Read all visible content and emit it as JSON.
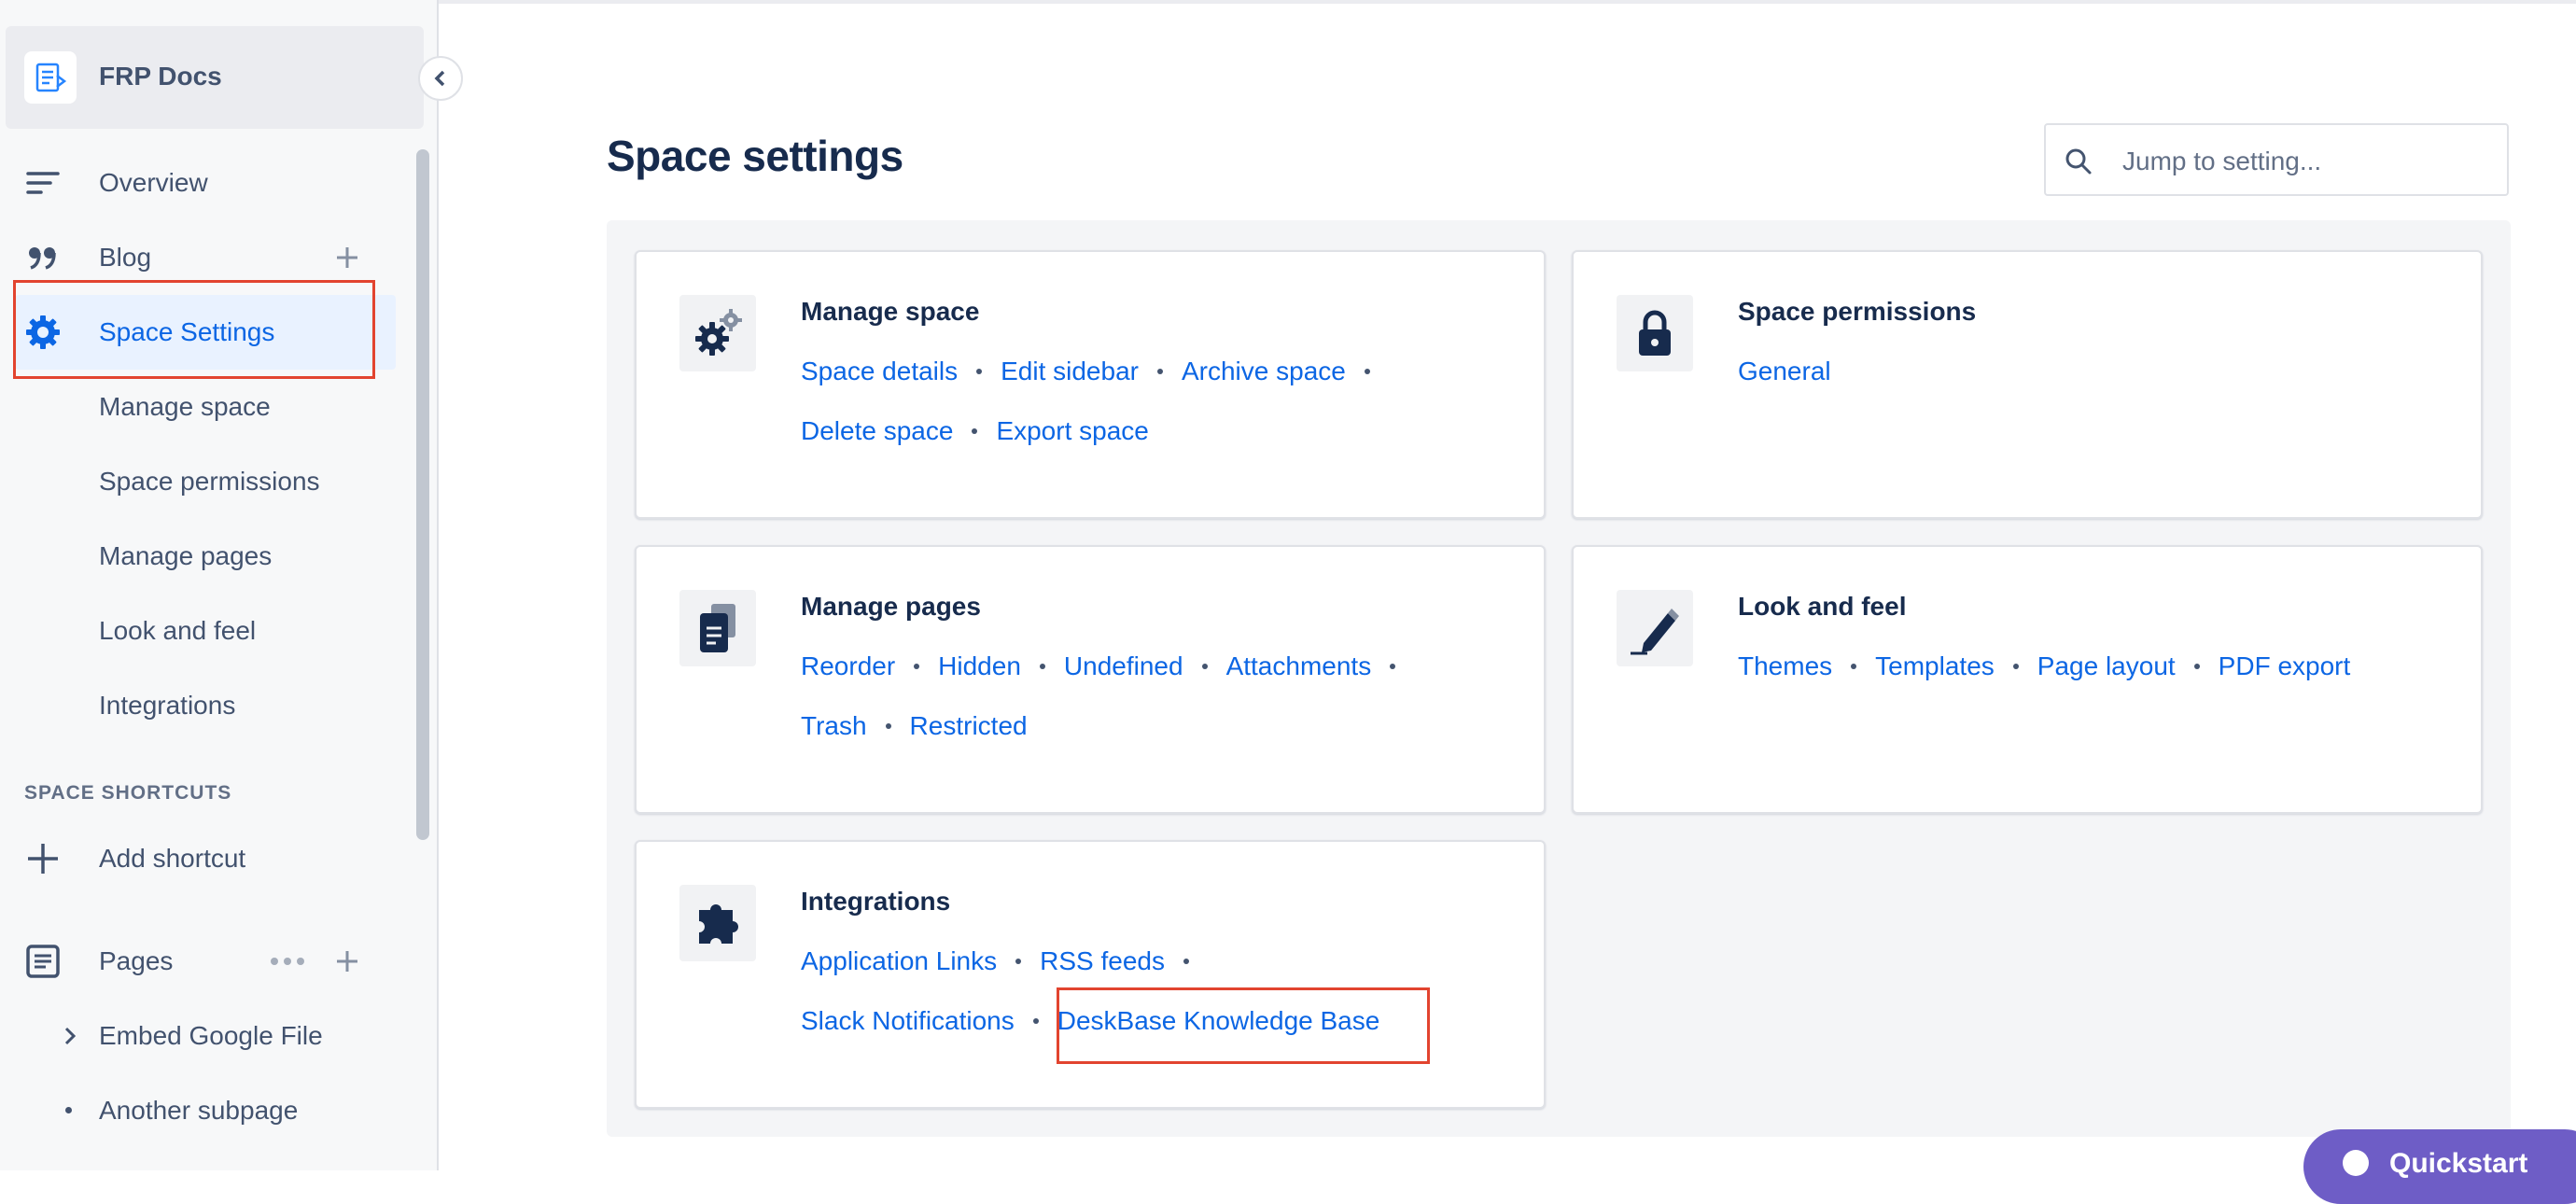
{
  "sidebar": {
    "space_title": "FRP Docs",
    "nav": {
      "overview": "Overview",
      "blog": "Blog",
      "space_settings": "Space Settings"
    },
    "settings_subitems": [
      "Manage space",
      "Space permissions",
      "Manage pages",
      "Look and feel",
      "Integrations"
    ],
    "shortcuts_heading": "SPACE SHORTCUTS",
    "add_shortcut": "Add shortcut",
    "pages_label": "Pages",
    "page_tree": [
      "Embed Google File",
      "Another subpage"
    ]
  },
  "main": {
    "title": "Space settings",
    "search": {
      "placeholder": "Jump to setting..."
    },
    "cards": {
      "manage_space": {
        "title": "Manage space",
        "links": [
          "Space details",
          "Edit sidebar",
          "Archive space",
          "Delete space",
          "Export space"
        ]
      },
      "space_permissions": {
        "title": "Space permissions",
        "links": [
          "General"
        ]
      },
      "manage_pages": {
        "title": "Manage pages",
        "links": [
          "Reorder",
          "Hidden",
          "Undefined",
          "Attachments",
          "Trash",
          "Restricted"
        ]
      },
      "look_and_feel": {
        "title": "Look and feel",
        "links": [
          "Themes",
          "Templates",
          "Page layout",
          "PDF export"
        ]
      },
      "integrations": {
        "title": "Integrations",
        "links": [
          "Application Links",
          "RSS feeds",
          "Slack Notifications",
          "DeskBase Knowledge Base"
        ]
      }
    },
    "quickstart_label": "Quickstart"
  },
  "icons": {
    "space_logo": "document-logo-icon",
    "collapse": "chevron-left-icon",
    "overview": "lines-icon",
    "blog": "quote-icon",
    "space_settings": "gear-icon",
    "add_shortcut": "plus-icon",
    "pages": "page-icon",
    "search": "search-icon",
    "manage_space": "gears-icon",
    "space_permissions": "lock-icon",
    "manage_pages": "pages-icon",
    "look_and_feel": "pencil-icon",
    "integrations": "puzzle-icon"
  },
  "colors": {
    "link": "#0c66e4",
    "active_bg": "#e9f2ff",
    "highlight": "#e2442f",
    "text": "#172b4d",
    "quickstart": "#6e5dc6"
  }
}
